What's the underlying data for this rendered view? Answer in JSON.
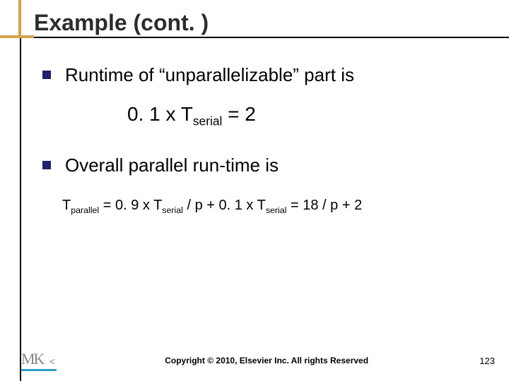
{
  "title": "Example (cont. )",
  "bullets": {
    "b1": "Runtime  of “unparallelizable” part is",
    "b2": "Overall parallel run-time is"
  },
  "equations": {
    "eq1_pre": "0. 1 x T",
    "eq1_sub": "serial",
    "eq1_post": " = 2",
    "eq2_t": "T",
    "eq2_sub_par": "parallel",
    "eq2_mid1": " = 0. 9 x T",
    "eq2_sub_ser1": "serial",
    "eq2_mid2": " / p + 0. 1 x T",
    "eq2_sub_ser2": "serial",
    "eq2_end": "  = 18 / p + 2"
  },
  "footer": {
    "copyright": "Copyright © 2010, Elsevier Inc. All rights Reserved",
    "page": "123",
    "logo_text": "MK",
    "logo_caret": "<"
  }
}
